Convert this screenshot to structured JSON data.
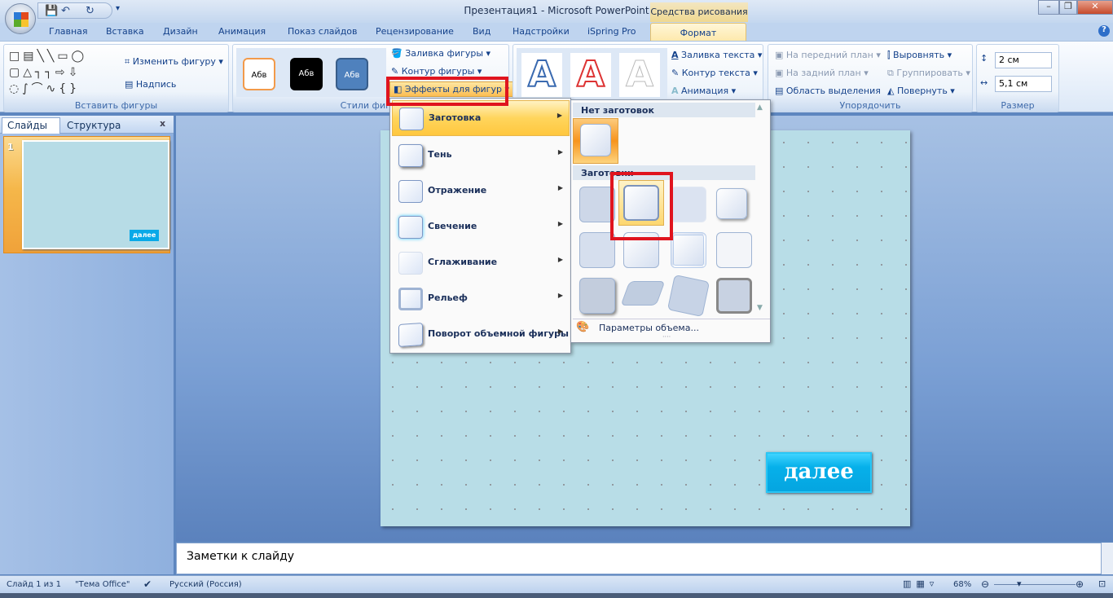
{
  "window": {
    "title": "Презентация1 - Microsoft PowerPoint",
    "context_tab": "Средства рисования",
    "help_icon": "help-icon"
  },
  "tabs": [
    "Главная",
    "Вставка",
    "Дизайн",
    "Анимация",
    "Показ слайдов",
    "Рецензирование",
    "Вид",
    "Надстройки",
    "iSpring Pro",
    "Формат"
  ],
  "ribbon": {
    "insert_shapes": {
      "label": "Вставить фигуры",
      "edit_shape": "Изменить фигуру",
      "textbox": "Надпись"
    },
    "shape_styles": {
      "label": "Стили фигур",
      "samples": [
        "Абв",
        "Абв",
        "Абв"
      ],
      "fill": "Заливка фигуры",
      "outline": "Контур фигуры",
      "effects": "Эффекты для фигур"
    },
    "wordart": {
      "samples": [
        "A",
        "A",
        "A"
      ],
      "text_fill": "Заливка текста",
      "text_outline": "Контур текста",
      "animation": "Анимация"
    },
    "arrange": {
      "label": "Упорядочить",
      "bring_front": "На передний план",
      "send_back": "На задний план",
      "selection_pane": "Область выделения",
      "align": "Выровнять",
      "group": "Группировать",
      "rotate": "Повернуть"
    },
    "size": {
      "label": "Размер",
      "height": "2 см",
      "width": "5,1 см"
    }
  },
  "left_pane": {
    "tabs": [
      "Слайды",
      "Структура"
    ],
    "slide_number": "1",
    "thumb_button": "далее"
  },
  "effects_menu": {
    "items": [
      "Заготовка",
      "Тень",
      "Отражение",
      "Свечение",
      "Сглаживание",
      "Рельеф",
      "Поворот объемной фигуры"
    ]
  },
  "preset_submenu": {
    "none_header": "Нет заготовок",
    "presets_header": "Заготовки",
    "options_link": "Параметры объема..."
  },
  "slide": {
    "button_text": "далее",
    "button_color": "#06b0ea",
    "background": "#b8dde7"
  },
  "notes": {
    "placeholder": "Заметки к слайду"
  },
  "status": {
    "slide": "Слайд 1 из 1",
    "theme": "\"Тема Office\"",
    "language": "Русский (Россия)",
    "zoom": "68%"
  },
  "highlight_color": "#e0141e"
}
